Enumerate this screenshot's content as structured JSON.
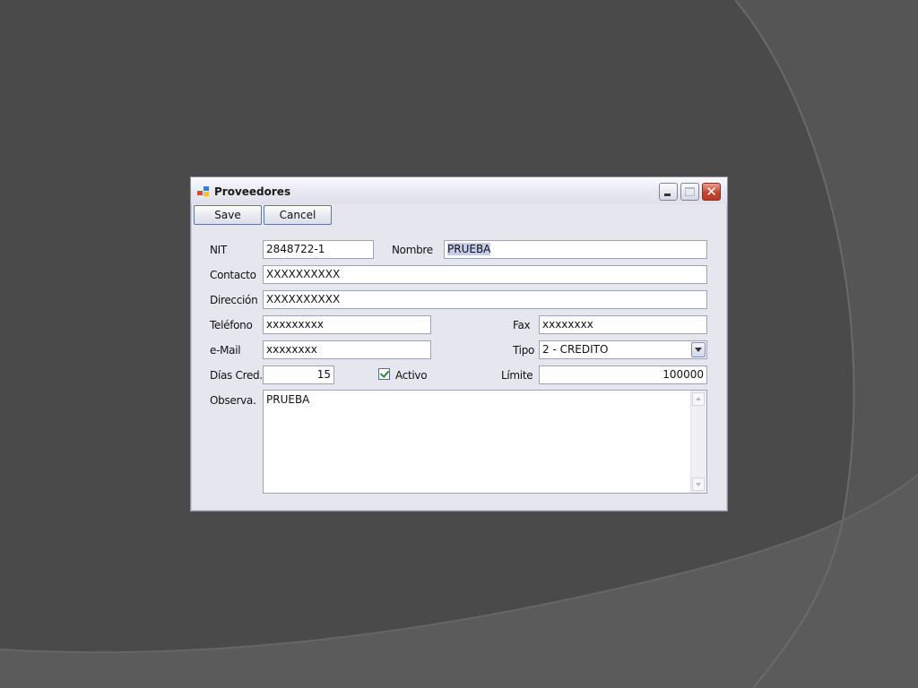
{
  "window": {
    "title": "Proveedores",
    "controls": {
      "minimize": "minimize",
      "maximize": "maximize",
      "close": "✕"
    }
  },
  "toolbar": {
    "save_label": "Save",
    "cancel_label": "Cancel"
  },
  "form": {
    "nit": {
      "label": "NIT",
      "value": "2848722-1"
    },
    "nombre": {
      "label": "Nombre",
      "value": "PRUEBA"
    },
    "contacto": {
      "label": "Contacto",
      "value": "XXXXXXXXXX"
    },
    "direccion": {
      "label": "Dirección",
      "value": "XXXXXXXXXX"
    },
    "telefono": {
      "label": "Teléfono",
      "value": "xxxxxxxxx"
    },
    "fax": {
      "label": "Fax",
      "value": "xxxxxxxx"
    },
    "email": {
      "label": "e-Mail",
      "value": "xxxxxxxx"
    },
    "tipo": {
      "label": "Tipo",
      "value": "2 - CREDITO"
    },
    "dias_cred": {
      "label": "Días Cred.",
      "value": "15"
    },
    "activo": {
      "label": "Activo",
      "checked": true
    },
    "limite": {
      "label": "Límite",
      "value": "100000"
    },
    "observa": {
      "label": "Observa.",
      "value": "PRUEBA"
    }
  },
  "icons": {
    "app": "app-window-icon",
    "dropdown": "chevron-down-icon",
    "scroll_up": "scroll-up-arrow-icon",
    "scroll_down": "scroll-down-arrow-icon"
  }
}
